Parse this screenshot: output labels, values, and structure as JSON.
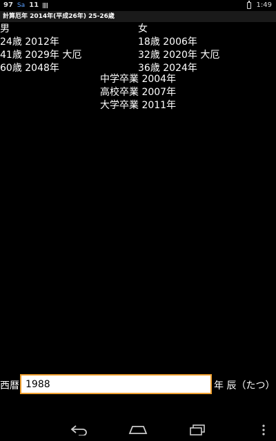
{
  "status_bar": {
    "left_num1": "97",
    "left_sa": "Sa",
    "left_num2": "11",
    "time": "1:49"
  },
  "title": "計算厄年 2014年(平成26年) 25-26歳",
  "male": {
    "label": "男",
    "lines": [
      "24歳 2012年",
      "41歳 2029年 大厄",
      "60歳 2048年"
    ]
  },
  "female": {
    "label": "女",
    "lines": [
      "18歳 2006年",
      "32歳 2020年 大厄",
      "36歳 2024年"
    ]
  },
  "school": [
    "中学卒業 2004年",
    "高校卒業 2007年",
    "大学卒業 2011年"
  ],
  "input": {
    "prefix": "西暦",
    "value": "1988",
    "suffix": "年 辰（たつ）"
  }
}
